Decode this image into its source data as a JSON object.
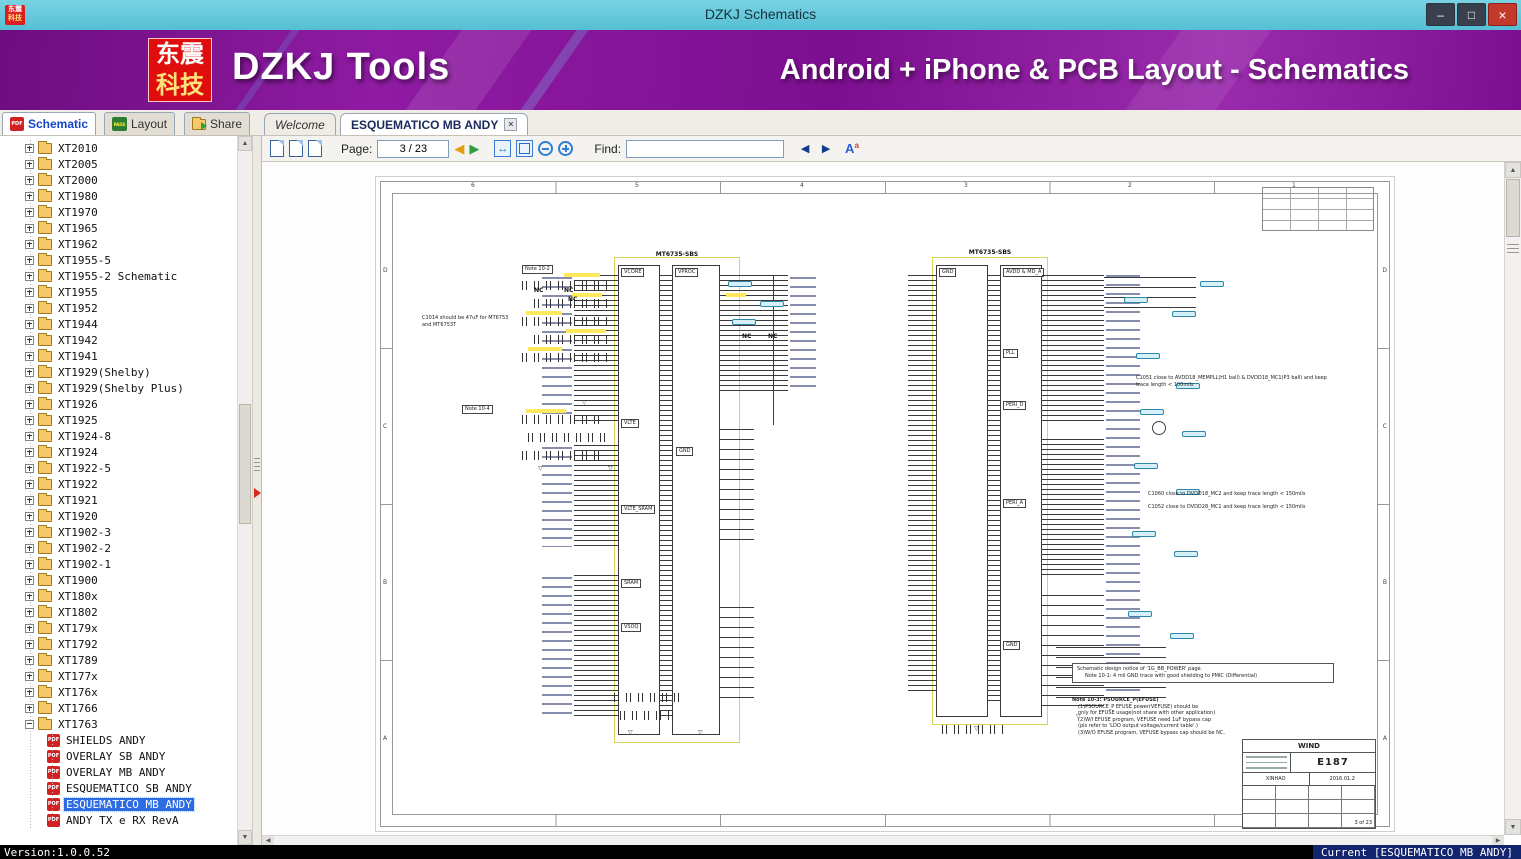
{
  "window": {
    "title": "DZKJ Schematics"
  },
  "banner": {
    "logo_top": "东震",
    "logo_bottom": "科技",
    "brand": "DZKJ Tools",
    "tagline": "Android + iPhone & PCB Layout - Schematics"
  },
  "main_tabs": [
    {
      "label": "Schematic"
    },
    {
      "label": "Layout"
    },
    {
      "label": "Share"
    }
  ],
  "doc_tabs": [
    {
      "label": "Welcome"
    },
    {
      "label": "ESQUEMATICO MB ANDY"
    }
  ],
  "toolbar": {
    "page_label": "Page:",
    "page_value": "3 / 23",
    "find_label": "Find:",
    "find_value": ""
  },
  "sidebar": {
    "folders": [
      "XT2010",
      "XT2005",
      "XT2000",
      "XT1980",
      "XT1970",
      "XT1965",
      "XT1962",
      "XT1955-5",
      "XT1955-2 Schematic",
      "XT1955",
      "XT1952",
      "XT1944",
      "XT1942",
      "XT1941",
      "XT1929(Shelby)",
      "XT1929(Shelby Plus)",
      "XT1926",
      "XT1925",
      "XT1924-8",
      "XT1924",
      "XT1922-5",
      "XT1922",
      "XT1921",
      "XT1920",
      "XT1902-3",
      "XT1902-2",
      "XT1902-1",
      "XT1900",
      "XT180x",
      "XT1802",
      "XT179x",
      "XT1792",
      "XT1789",
      "XT177x",
      "XT176x",
      "XT1766"
    ],
    "expanded_folder": "XT1763",
    "files": [
      {
        "label": "SHIELDS ANDY"
      },
      {
        "label": "OVERLAY SB ANDY"
      },
      {
        "label": "OVERLAY MB ANDY"
      },
      {
        "label": "ESQUEMATICO SB ANDY"
      },
      {
        "label": "ESQUEMATICO MB ANDY",
        "selected": true
      },
      {
        "label": "ANDY TX e RX RevA"
      }
    ]
  },
  "schematic": {
    "grid_cols": [
      "6",
      "5",
      "4",
      "3",
      "2",
      "1"
    ],
    "grid_rows": [
      "D",
      "C",
      "B",
      "A"
    ],
    "chip_left": {
      "title": "MT6735-SBS",
      "header_a": "VCORE",
      "header_b": "VPROC",
      "gnd": "GND",
      "sections": [
        "VLTE",
        "VLTE_SRAM",
        "SRAM",
        "VSOQ"
      ]
    },
    "chip_right": {
      "title": "MT6735-SBS",
      "header_a": "GND",
      "header_b": "AVDD & MD_A",
      "sections": [
        "PLL",
        "PERI_D",
        "PERI_A",
        "GND"
      ]
    },
    "nc_label": "NC",
    "notes": {
      "c1014": "C1014 should be 47uF for MT6753 and MT6753T",
      "note_tag_1": "Note 10-2",
      "note_tag_2": "Note 10-4",
      "c1051": "C1051 close to AVDD18_MEMPLL(H1 ball) & DVDD18_MC1(P3 ball) and keep trace length < 100mils",
      "c1060": "C1060 close to DVDD18_MC2 and keep trace length < 150mils",
      "c1052": "C1052 close to DVDD28_MC1 and keep trace length < 150mils",
      "notice_title": "Schematic design notice of '1G_BB_POWER' page.",
      "note_10_1": "Note 10-1: 4 mil GND trace with good shielding to PMIC (Differential)",
      "note_10_3_title": "Note 10-3: PSOURCE_P(EFUSE)",
      "note_10_3_lines": [
        "(1)PSOURCE_P EFUSE power(VEFUSE) should be",
        "only for EFUSE usage(not share with other application)",
        "(2)W/I EFUSE program, VEFUSE need 1uF bypass cap",
        "(pls refer to 'LDO output voltage/current table'.)",
        "(3)W/O EFUSE program, VEFUSE bypass cap should be NC."
      ]
    },
    "title_block": {
      "company": "WIND",
      "code": "E187",
      "drawn": "XINHAO",
      "date": "2016.01.2",
      "sheet": "3 of 23"
    }
  },
  "statusbar": {
    "version": "Version:1.0.0.52",
    "current": "Current [ESQUEMATICO MB ANDY]"
  }
}
